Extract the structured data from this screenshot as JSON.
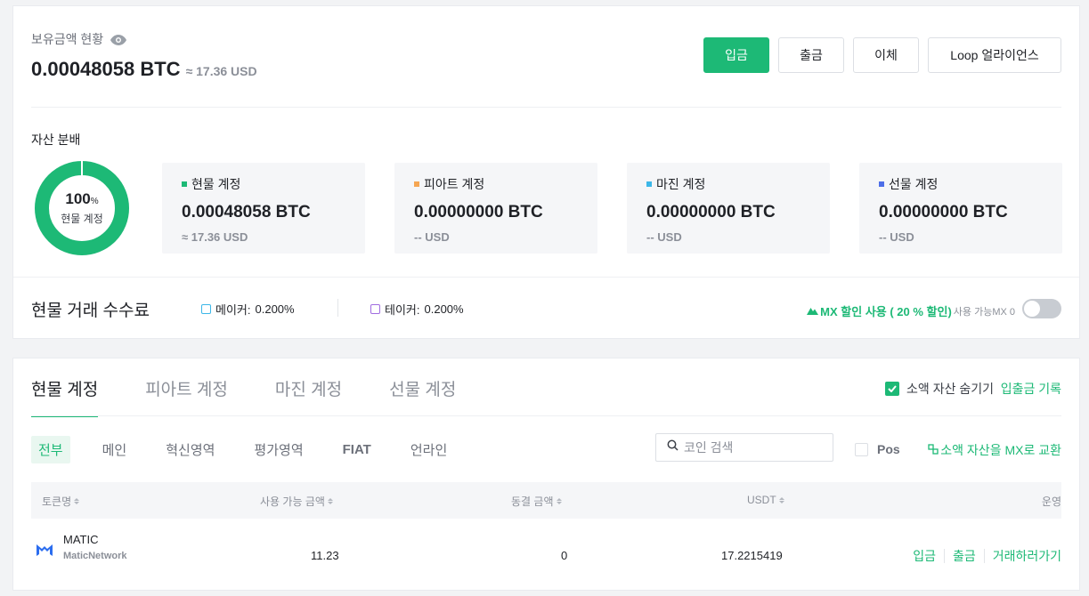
{
  "overview": {
    "title": "보유금액 현황",
    "balance_btc": "0.00048058 BTC",
    "balance_usd": "≈ 17.36 USD",
    "buttons": {
      "deposit": "입금",
      "withdraw": "출금",
      "transfer": "이체",
      "loop": "Loop 얼라이언스"
    }
  },
  "distribution": {
    "title": "자산 분배",
    "donut": {
      "percent": "100",
      "percent_sign": "%",
      "label": "현물 계정",
      "fill_fraction": 1.0,
      "color": "#1db976"
    },
    "accounts": [
      {
        "name": "현물 계정",
        "value": "0.00048058 BTC",
        "usd": "≈ 17.36 USD",
        "color": "#1db976"
      },
      {
        "name": "피아트 계정",
        "value": "0.00000000 BTC",
        "usd": "-- USD",
        "color": "#f5a653"
      },
      {
        "name": "마진 계정",
        "value": "0.00000000 BTC",
        "usd": "-- USD",
        "color": "#3cb7e8"
      },
      {
        "name": "선물 계정",
        "value": "0.00000000 BTC",
        "usd": "-- USD",
        "color": "#4d6ee8"
      }
    ]
  },
  "fees": {
    "title": "현물 거래 수수료",
    "maker_label": "메이커:",
    "maker_value": "0.200%",
    "taker_label": "테이커:",
    "taker_value": "0.200%",
    "mx_discount": "MX 할인 사용 ( 20 % 할인)",
    "mx_available": "사용 가능MX 0",
    "mx_toggle_on": false
  },
  "spot": {
    "tabs": [
      "현물 계정",
      "피아트 계정",
      "마진 계정",
      "선물 계정"
    ],
    "active_tab": 0,
    "hide_small_label": "소액 자산 숨기기",
    "hide_small_checked": true,
    "history_link": "입출금 기록",
    "subtabs": [
      "전부",
      "메인",
      "혁신영역",
      "평가영역",
      "FIAT",
      "언라인"
    ],
    "search_placeholder": "코인 검색",
    "pos_label": "Pos",
    "convert_link": "소액 자산을 MX로 교환",
    "columns": [
      "토큰명",
      "사용 가능 금액",
      "동결 금액",
      "USDT",
      "운영"
    ],
    "rows": [
      {
        "symbol": "MATIC",
        "fullname": "MaticNetwork",
        "available": "11.23",
        "frozen": "0",
        "usdt": "17.2215419",
        "actions": [
          "입금",
          "출금",
          "거래하러가기"
        ]
      }
    ]
  },
  "colors": {
    "accent": "#1db976",
    "fiat": "#f5a653",
    "margin": "#3cb7e8",
    "futures": "#4d6ee8",
    "matic": "#2b6def"
  }
}
